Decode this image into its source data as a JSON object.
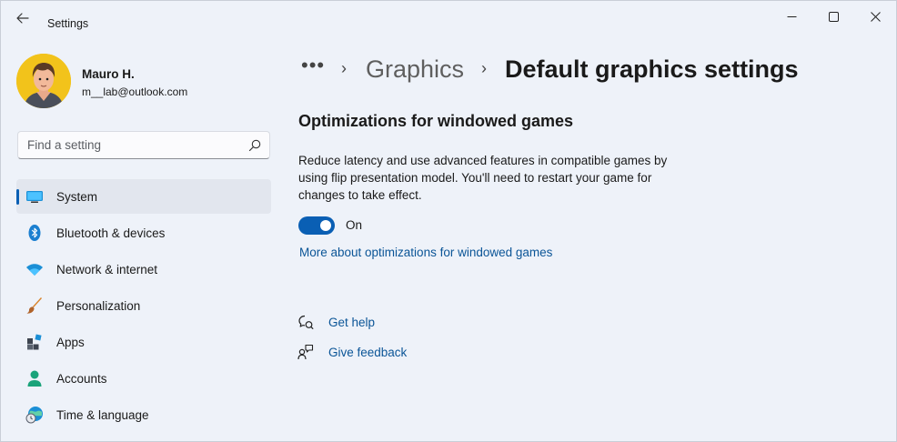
{
  "window": {
    "title": "Settings"
  },
  "user": {
    "name": "Mauro H.",
    "email": "m__lab@outlook.com"
  },
  "search": {
    "placeholder": "Find a setting"
  },
  "sidebar": {
    "items": [
      {
        "label": "System",
        "icon": "system-icon",
        "active": true
      },
      {
        "label": "Bluetooth & devices",
        "icon": "bluetooth-icon"
      },
      {
        "label": "Network & internet",
        "icon": "wifi-icon"
      },
      {
        "label": "Personalization",
        "icon": "brush-icon"
      },
      {
        "label": "Apps",
        "icon": "apps-icon"
      },
      {
        "label": "Accounts",
        "icon": "accounts-icon"
      },
      {
        "label": "Time & language",
        "icon": "time-language-icon"
      }
    ]
  },
  "breadcrumb": {
    "overflow": "•••",
    "separator": "›",
    "parent": "Graphics",
    "current": "Default graphics settings"
  },
  "main": {
    "section_title": "Optimizations for windowed games",
    "description": "Reduce latency and use advanced features in compatible games by using flip presentation model. You'll need to restart your game for changes to take effect.",
    "toggle": {
      "state_label": "On",
      "on": true
    },
    "link": "More about optimizations for windowed games"
  },
  "help": {
    "get_help": "Get help",
    "give_feedback": "Give feedback"
  },
  "colors": {
    "accent": "#0a5fb4",
    "link": "#0b5597",
    "background": "#eef2f9",
    "avatar_bg": "#f2c31b"
  }
}
